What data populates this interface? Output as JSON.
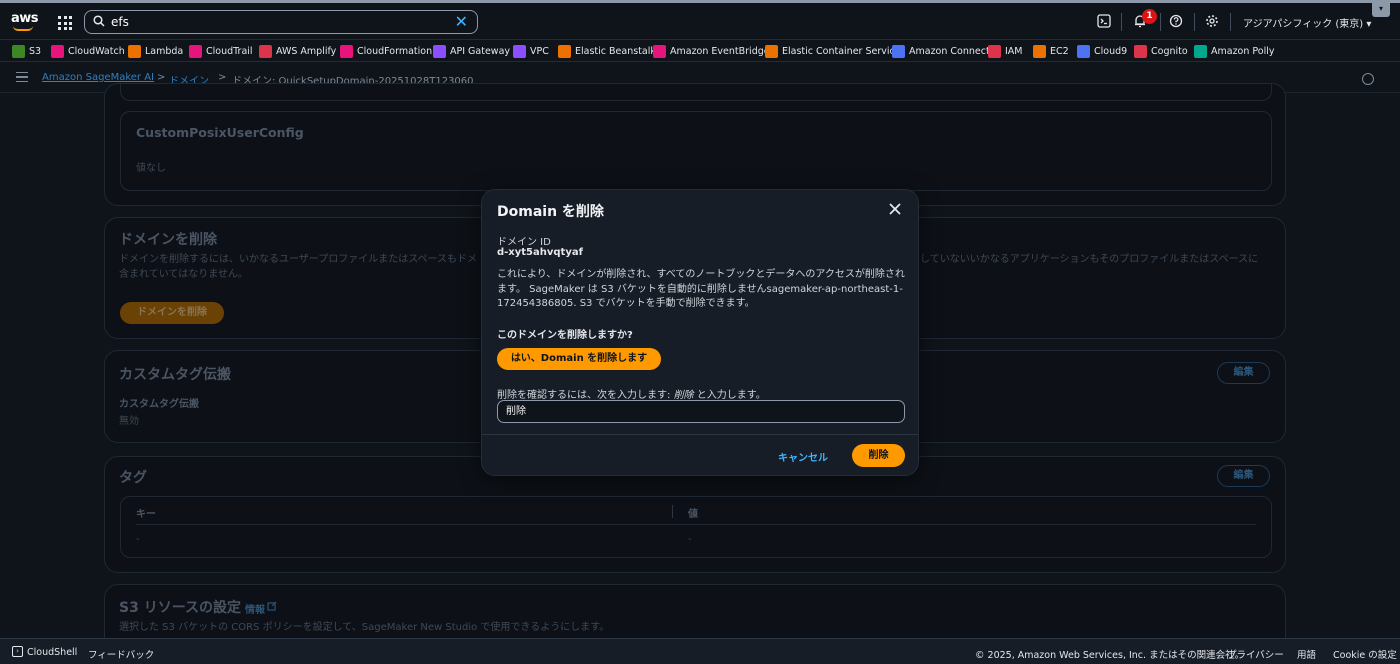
{
  "nav": {
    "logo": "aws",
    "search_value": "efs",
    "notification_count": "1",
    "region": "アジアパシフィック (東京) ▾",
    "corner_glyph": "▾"
  },
  "favorites": [
    {
      "label": "S3",
      "color": "#3f8624"
    },
    {
      "label": "CloudWatch",
      "color": "#e7157b"
    },
    {
      "label": "Lambda",
      "color": "#ed7100"
    },
    {
      "label": "CloudTrail",
      "color": "#e7157b"
    },
    {
      "label": "AWS Amplify",
      "color": "#dd344c"
    },
    {
      "label": "CloudFormation",
      "color": "#e7157b"
    },
    {
      "label": "API Gateway",
      "color": "#8c4fff"
    },
    {
      "label": "VPC",
      "color": "#8c4fff"
    },
    {
      "label": "Elastic Beanstalk",
      "color": "#ed7100"
    },
    {
      "label": "Amazon EventBridge",
      "color": "#e7157b"
    },
    {
      "label": "Elastic Container Service",
      "color": "#ed7100"
    },
    {
      "label": "Amazon Connect",
      "color": "#4d72f3"
    },
    {
      "label": "IAM",
      "color": "#dd344c"
    },
    {
      "label": "EC2",
      "color": "#ed7100"
    },
    {
      "label": "Cloud9",
      "color": "#4d72f3"
    },
    {
      "label": "Cognito",
      "color": "#dd344c"
    },
    {
      "label": "Amazon Polly",
      "color": "#01a88d"
    }
  ],
  "breadcrumb": {
    "item1": "Amazon SageMaker AI",
    "item2": "ドメイン",
    "item3": "ドメイン: QuickSetupDomain-20251028T123060",
    "sep": ">"
  },
  "background": {
    "posix_title": "CustomPosixUserConfig",
    "posix_value": "値なし",
    "delete_section_title": "ドメインを削除",
    "delete_section_desc_left": "ドメインを削除するには、いかなるユーザープロファイルまたはスペースもドメ",
    "delete_section_desc_right": "していないいかなるアプリケーションもそのプロファイルまたはスペースに",
    "delete_section_desc_line2": "含まれていてはなりません。",
    "delete_section_button": "ドメインを削除",
    "tag_prop_title": "カスタムタグ伝搬",
    "tag_prop_label": "カスタムタグ伝搬",
    "tag_prop_value": "無効",
    "edit": "編集",
    "tags_title": "タグ",
    "tags_col_key": "キー",
    "tags_col_value": "値",
    "tags_key_value": "-",
    "tags_val_value": "-",
    "s3_title": "S3 リソースの設定",
    "s3_info": "情報",
    "s3_desc": "選択した S3 バケットの CORS ポリシーを設定して、SageMaker New Studio で使用できるようにします。"
  },
  "modal": {
    "title": "Domain を削除",
    "domain_id_label": "ドメイン ID",
    "domain_id_value": "d-xyt5ahvqtyaf",
    "description": "これにより、ドメインが削除され、すべてのノートブックとデータへのアクセスが削除されます。 SageMaker は S3 バケットを自動的に削除しませんsagemaker-ap-northeast-1-172454386805. S3 でバケットを手動で削除できます。",
    "question": "このドメインを削除しますか?",
    "yes_button": "はい、Domain を削除します",
    "confirm_prefix": "削除を確認するには、次を入力します: ",
    "confirm_word": "削除",
    "confirm_suffix": " と入力します。",
    "confirm_input_value": "削除",
    "cancel_label": "キャンセル",
    "delete_label": "削除"
  },
  "footer": {
    "cloudshell": "CloudShell",
    "feedback": "フィードバック",
    "copyright": "© 2025, Amazon Web Services, Inc. またはその関連会社。",
    "privacy": "プライバシー",
    "terms": "用語",
    "cookie": "Cookie の設定"
  }
}
